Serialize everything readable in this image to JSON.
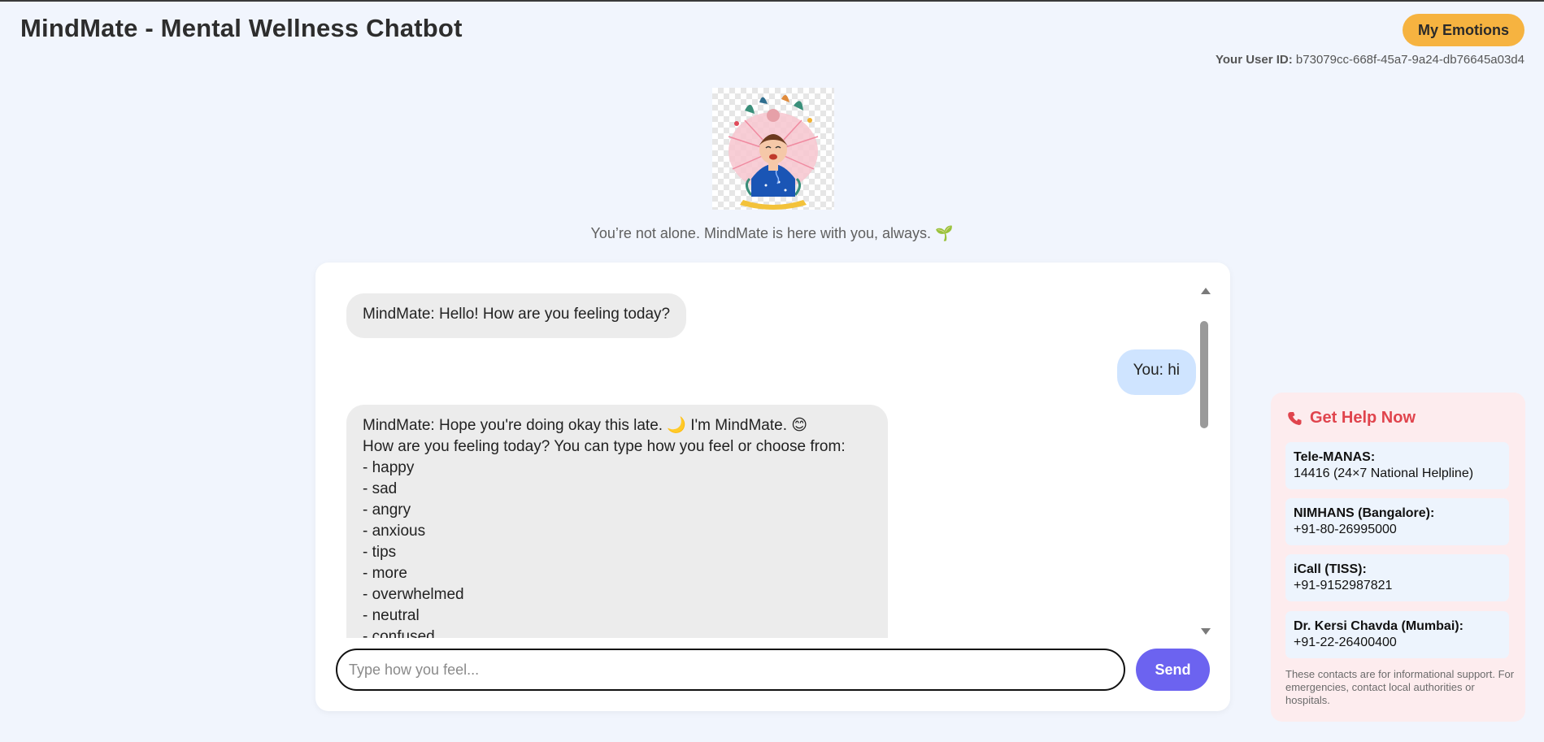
{
  "header": {
    "title": "MindMate - Mental Wellness Chatbot",
    "emotions_button": "My Emotions",
    "user_id_label": "Your User ID:",
    "user_id_value": "b73079cc-668f-45a7-9a24-db76645a03d4"
  },
  "hero": {
    "tagline": "You’re not alone. MindMate is here with you, always. 🌱"
  },
  "chat": {
    "messages": [
      {
        "sender": "bot",
        "text": "MindMate: Hello! How are you feeling today?"
      },
      {
        "sender": "user",
        "text": "You: hi"
      },
      {
        "sender": "bot",
        "lines": [
          "MindMate: Hope you're doing okay this late. 🌙 I'm MindMate. 😊",
          "How are you feeling today? You can type how you feel or choose from:",
          "- happy",
          "- sad",
          "- angry",
          "- anxious",
          "- tips",
          "- more",
          "- overwhelmed",
          "- neutral",
          "- confused"
        ]
      }
    ],
    "input_placeholder": "Type how you feel...",
    "input_value": "",
    "send_label": "Send"
  },
  "help": {
    "title": "Get Help Now",
    "contacts": [
      {
        "name": "Tele-MANAS:",
        "number": "14416 (24×7 National Helpline)"
      },
      {
        "name": "NIMHANS (Bangalore):",
        "number": "+91-80-26995000"
      },
      {
        "name": "iCall (TISS):",
        "number": "+91-9152987821"
      },
      {
        "name": "Dr. Kersi Chavda (Mumbai):",
        "number": "+91-22-26400400"
      }
    ],
    "note": "These contacts are for informational support. For emergencies, contact local authorities or hospitals."
  },
  "colors": {
    "background": "#f1f5fd",
    "accent_button": "#f6b340",
    "send_button": "#6c63f0",
    "bot_bubble": "#ececec",
    "user_bubble": "#cfe4ff",
    "help_panel": "#fdecee",
    "help_title": "#e0444d"
  },
  "icons": {
    "avatar": "wellness-illustration",
    "help": "phone-icon"
  }
}
